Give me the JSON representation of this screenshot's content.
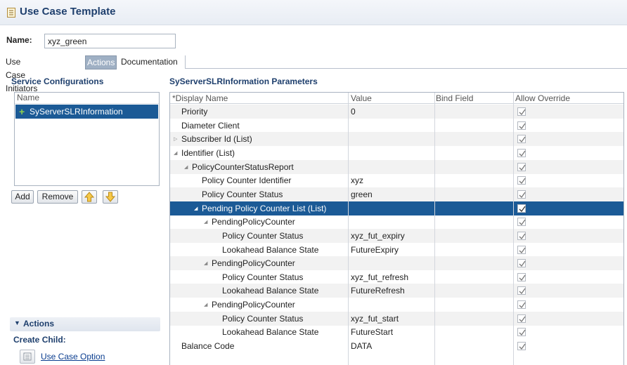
{
  "window": {
    "title": "Use Case Template"
  },
  "name_field": {
    "label": "Name:",
    "value": "xyz_green"
  },
  "tabs": [
    {
      "label": "Use Case Initiators"
    },
    {
      "label": "Actions",
      "active": true
    },
    {
      "label": "Documentation"
    }
  ],
  "service_configs": {
    "title": "Service Configurations",
    "column": "Name",
    "items": [
      "SyServerSLRInformation"
    ],
    "buttons": {
      "add": "Add",
      "remove": "Remove"
    }
  },
  "actions_panel": {
    "title": "Actions",
    "create_child": "Create Child:",
    "option": "Use Case Option"
  },
  "params": {
    "title": "SyServerSLRInformation Parameters",
    "columns": [
      "*Display Name",
      "Value",
      "Bind Field",
      "Allow Override"
    ],
    "rows": [
      {
        "name": "Priority",
        "value": "0"
      },
      {
        "name": "Diameter Client",
        "value": ""
      },
      {
        "name": "Subscriber Id (List)",
        "value": ""
      },
      {
        "name": "Identifier (List)",
        "value": ""
      },
      {
        "name": "PolicyCounterStatusReport",
        "value": ""
      },
      {
        "name": "Policy Counter Identifier",
        "value": "xyz"
      },
      {
        "name": "Policy Counter Status",
        "value": "green"
      },
      {
        "name": "Pending Policy Counter List (List)",
        "value": ""
      },
      {
        "name": "PendingPolicyCounter",
        "value": ""
      },
      {
        "name": "Policy Counter Status",
        "value": "xyz_fut_expiry"
      },
      {
        "name": "Lookahead Balance State",
        "value": "FutureExpiry"
      },
      {
        "name": "PendingPolicyCounter",
        "value": ""
      },
      {
        "name": "Policy Counter Status",
        "value": "xyz_fut_refresh"
      },
      {
        "name": "Lookahead Balance State",
        "value": "FutureRefresh"
      },
      {
        "name": "PendingPolicyCounter",
        "value": ""
      },
      {
        "name": "Policy Counter Status",
        "value": "xyz_fut_start"
      },
      {
        "name": "Lookahead Balance State",
        "value": "FutureStart"
      },
      {
        "name": "Balance Code",
        "value": "DATA"
      }
    ]
  },
  "colors": {
    "accent": "#1b5a96",
    "heading": "#1e3f6d",
    "tab_active": "#9fb0c4"
  }
}
